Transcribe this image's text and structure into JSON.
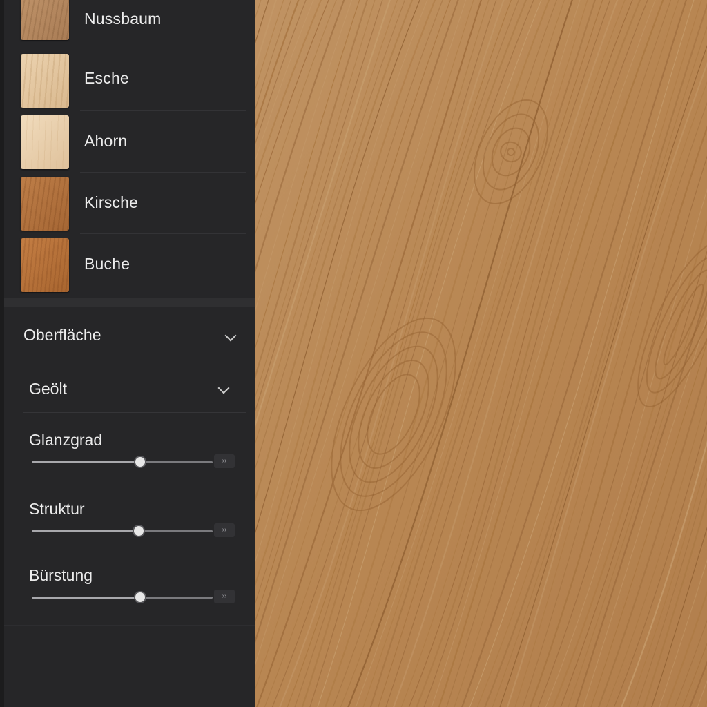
{
  "wood_types": [
    {
      "name": "Nussbaum",
      "swatch": "sw-nuss"
    },
    {
      "name": "Esche",
      "swatch": "sw-esche"
    },
    {
      "name": "Ahorn",
      "swatch": "sw-ahorn"
    },
    {
      "name": "Kirsche",
      "swatch": "sw-kirsche"
    },
    {
      "name": "Buche",
      "swatch": "sw-buche"
    }
  ],
  "surface": {
    "label": "Oberfläche",
    "icon": "chevron-down-icon"
  },
  "finish": {
    "selected": "Geölt",
    "icon": "chevron-down-icon"
  },
  "sliders": [
    {
      "label": "Glanzgrad",
      "value_fraction": 0.6,
      "end_icon": "slider-end-icon"
    },
    {
      "label": "Struktur",
      "value_fraction": 0.59,
      "end_icon": "slider-end-icon"
    },
    {
      "label": "Bürstung",
      "value_fraction": 0.6,
      "end_icon": "slider-end-icon"
    }
  ],
  "colors": {
    "sidebar_bg": "#262628",
    "text": "#ececec",
    "wood_preview": "#b98a58"
  }
}
